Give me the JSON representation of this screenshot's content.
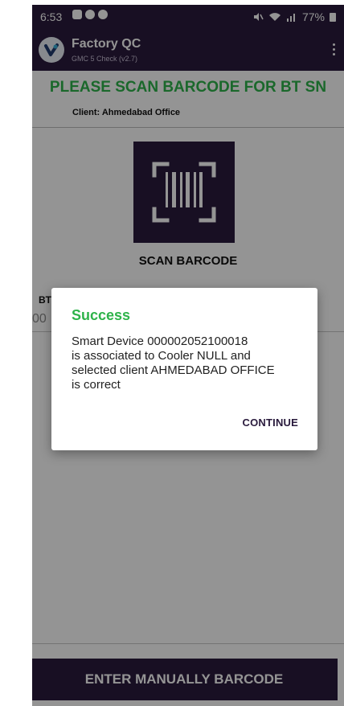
{
  "status_bar": {
    "time": "6:53",
    "right_text": "77%",
    "icons": [
      "image-icon",
      "vpn-icon",
      "vpn-icon",
      "mute-icon",
      "wifi-icon",
      "signal-icon",
      "battery-icon"
    ]
  },
  "app_bar": {
    "title": "Factory QC",
    "subtitle": "GMC 5 Check (v2.7)",
    "menu_icon": "kebab-menu-icon"
  },
  "screen": {
    "heading": "PLEASE SCAN BARCODE FOR BT SN",
    "client": "Client: Ahmedabad Office",
    "scan_label": "SCAN BARCODE",
    "field_label_partial": "BT",
    "field_value_partial": "00",
    "manual_button": "ENTER MANUALLY BARCODE"
  },
  "dialog": {
    "title": "Success",
    "message": "Smart Device 000002052100018\nis associated to Cooler NULL and\nselected client AHMEDABAD OFFICE\nis correct",
    "button": "CONTINUE"
  },
  "colors": {
    "primary": "#2a1b3d",
    "success": "#2eb34a"
  }
}
